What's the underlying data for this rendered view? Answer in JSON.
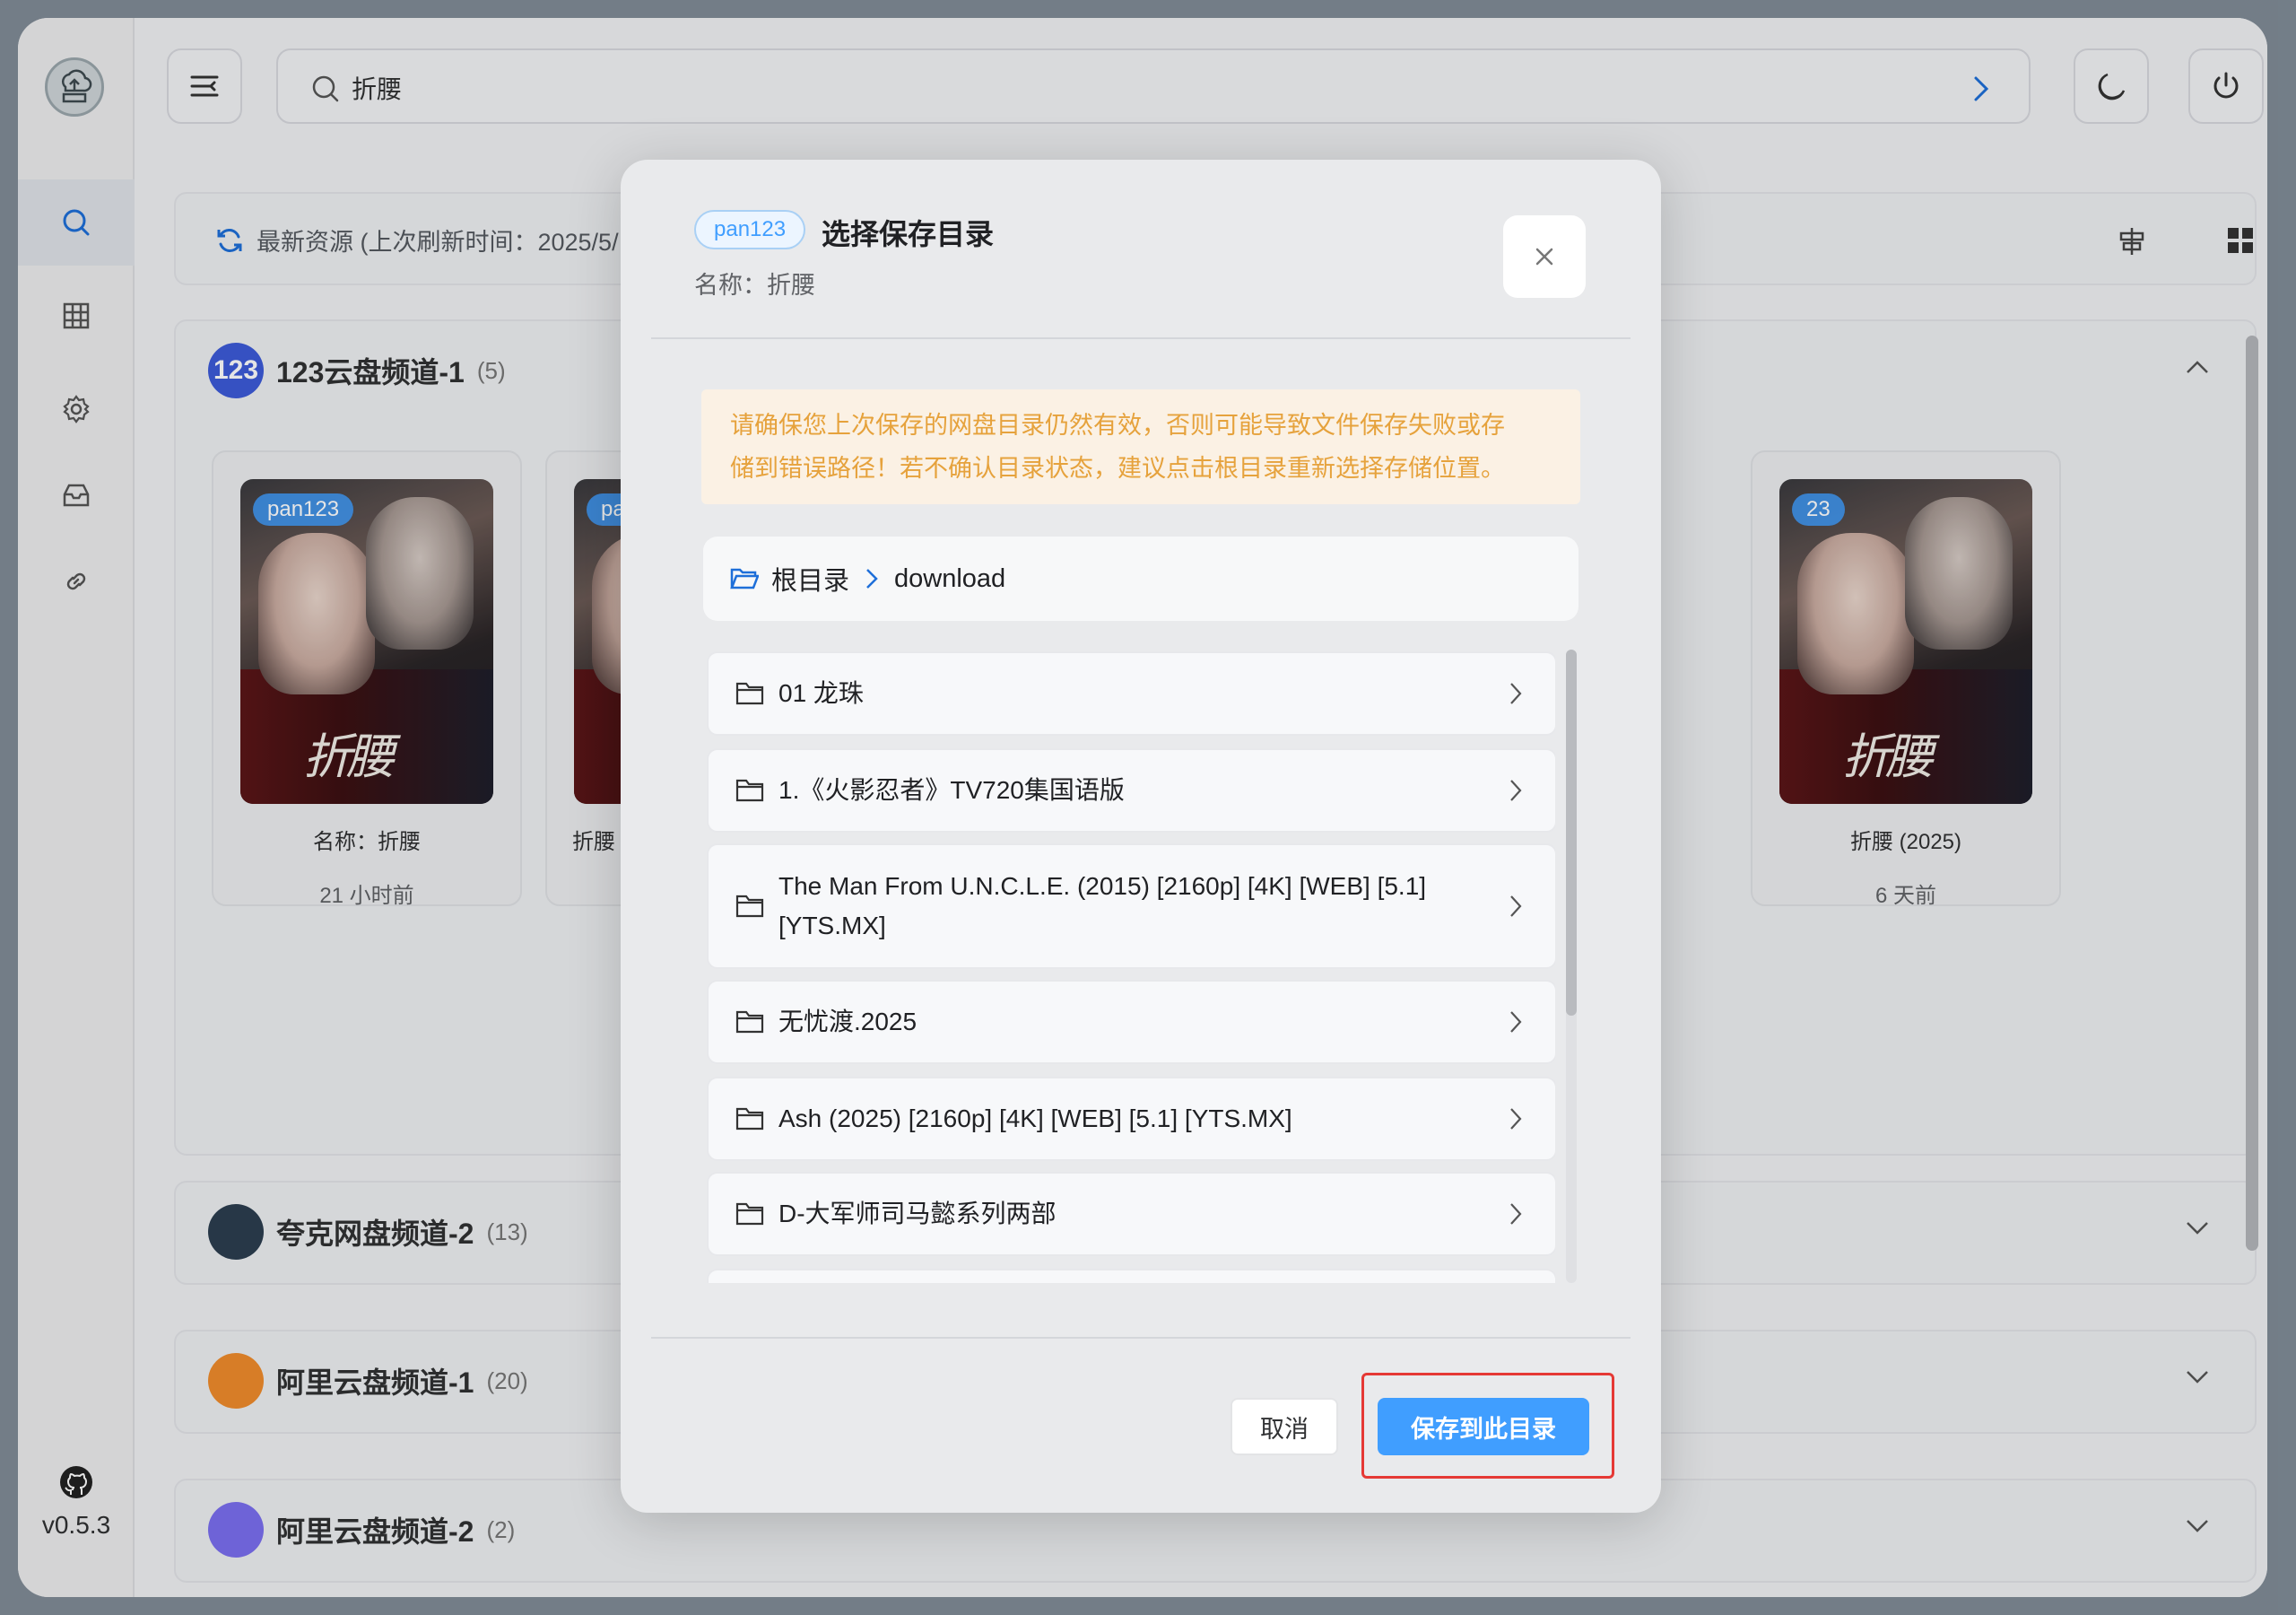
{
  "app": {
    "version": "v0.5.3"
  },
  "search": {
    "query": "折腰"
  },
  "toolbar": {
    "title": "最新资源 (上次刷新时间：2025/5/"
  },
  "channels": [
    {
      "name": "123云盘频道-1",
      "count": "(5)",
      "logo_text": "123",
      "color": "#3d5bd9",
      "expanded": true
    },
    {
      "name": "夸克网盘频道-2",
      "count": "(13)",
      "color": "#2c3e50",
      "expanded": false
    },
    {
      "name": "阿里云盘频道-1",
      "count": "(20)",
      "color": "#f08c2c",
      "expanded": false
    },
    {
      "name": "阿里云盘频道-2",
      "count": "(2)",
      "color": "#7b6ff0",
      "expanded": false
    }
  ],
  "cards": [
    {
      "badge": "pan123",
      "name": "名称：折腰",
      "time": "21 小时前"
    },
    {
      "badge": "pa",
      "name": "折腰",
      "time": ""
    },
    {
      "badge": "23",
      "name": "折腰 (2025)",
      "time": "6 天前"
    }
  ],
  "modal": {
    "tag": "pan123",
    "title": "选择保存目录",
    "subtitle": "名称：折腰",
    "warning_line1": "请确保您上次保存的网盘目录仍然有效，否则可能导致文件保存失败或存",
    "warning_line2": "储到错误路径！若不确认目录状态，建议点击根目录重新选择存储位置。",
    "breadcrumb": {
      "root": "根目录",
      "current": "download"
    },
    "folders": [
      "01 龙珠",
      "1.《火影忍者》TV720集国语版",
      "The Man From U.N.C.L.E. (2015) [2160p] [4K] [WEB] [5.1] [YTS.MX]",
      "无忧渡.2025",
      "Ash (2025) [2160p] [4K] [WEB] [5.1] [YTS.MX]",
      "D-大军师司马懿系列两部"
    ],
    "cancel_label": "取消",
    "save_label": "保存到此目录"
  },
  "colors": {
    "accent": "#409eff",
    "warning": "#e6a23c",
    "highlight": "#e53935"
  }
}
